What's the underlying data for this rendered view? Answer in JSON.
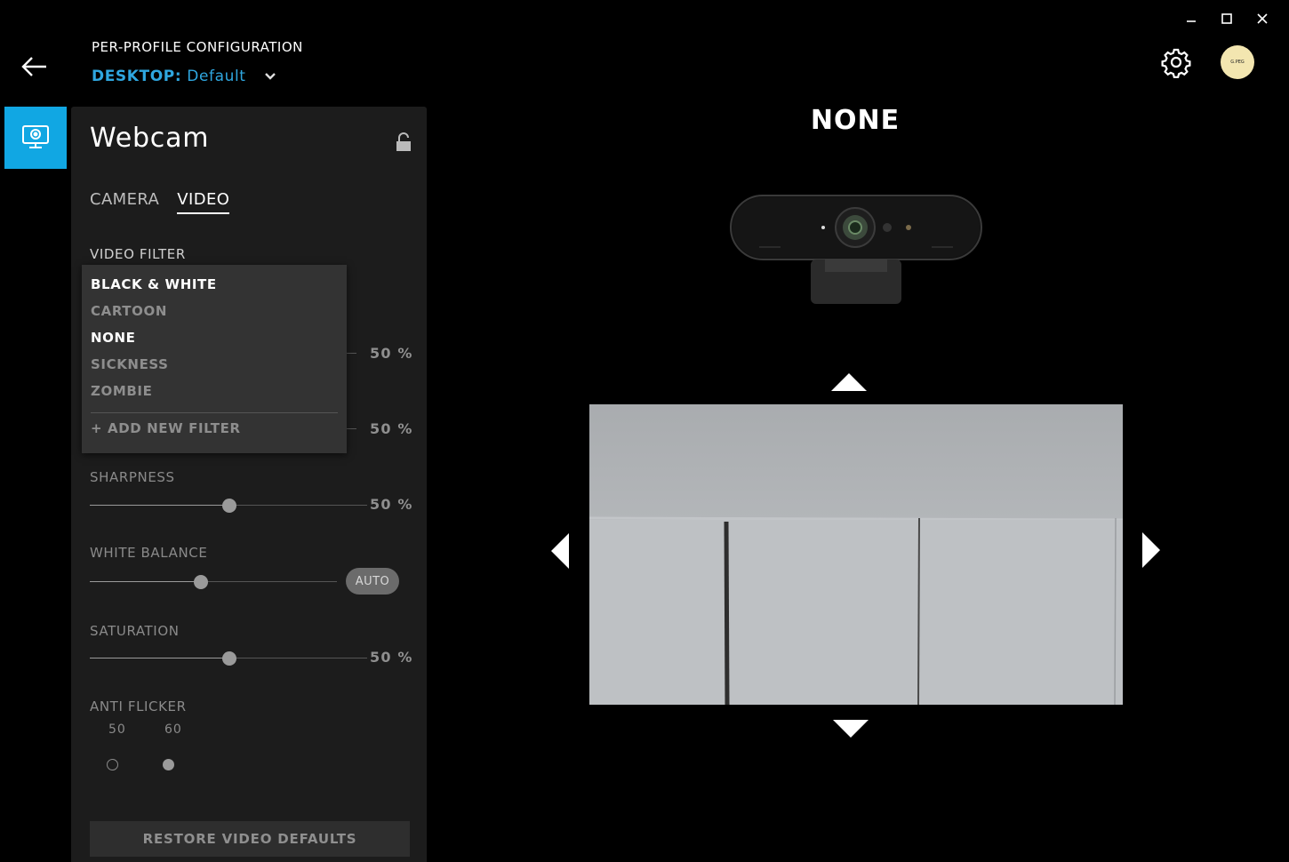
{
  "header": {
    "title": "PER-PROFILE CONFIGURATION",
    "device_label": "DESKTOP:",
    "profile_name": "Default"
  },
  "avatar_text": "G.PEG",
  "panel": {
    "title": "Webcam",
    "tabs": [
      {
        "label": "CAMERA",
        "active": false
      },
      {
        "label": "VIDEO",
        "active": true
      }
    ],
    "video_filter_label": "VIDEO FILTER",
    "sliders": {
      "slider1_value": "50 %",
      "slider2_value": "50 %",
      "sharpness_label": "SHARPNESS",
      "sharpness_value": "50 %",
      "white_balance_label": "WHITE BALANCE",
      "white_balance_auto": "AUTO",
      "saturation_label": "SATURATION",
      "saturation_value": "50 %"
    },
    "anti_flicker": {
      "label": "ANTI FLICKER",
      "options": [
        "50",
        "60"
      ],
      "selected": "60"
    },
    "restore_label": "RESTORE VIDEO DEFAULTS"
  },
  "filter_dropdown": {
    "items": [
      "BLACK & WHITE",
      "CARTOON",
      "NONE",
      "SICKNESS",
      "ZOMBIE"
    ],
    "highlighted": [
      "BLACK & WHITE",
      "NONE"
    ],
    "add_label": "+ ADD NEW FILTER"
  },
  "preview": {
    "current_filter": "NONE"
  },
  "colors": {
    "accent": "#2fa7e0",
    "device_tab": "#11a7e3",
    "panel_bg": "#1c1c1c"
  },
  "icons": {
    "back": "arrow-left-icon",
    "settings": "gear-icon",
    "lock": "unlock-icon",
    "device": "webcam-icon",
    "minimize": "minimize-icon",
    "maximize": "maximize-icon",
    "close": "close-icon"
  }
}
